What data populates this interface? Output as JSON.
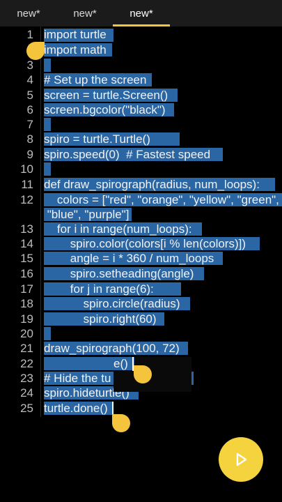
{
  "tabs": [
    {
      "label": "new*",
      "active": false
    },
    {
      "label": "new*",
      "active": false
    },
    {
      "label": "new*",
      "active": true
    }
  ],
  "editor": {
    "line_numbers": [
      "1",
      "2",
      "3",
      "4",
      "5",
      "6",
      "7",
      "8",
      "9",
      "10",
      "11",
      "12",
      "13",
      "14",
      "15",
      "16",
      "17",
      "18",
      "19",
      "20",
      "21",
      "22",
      "23",
      "24",
      "25"
    ],
    "code_lines": [
      "import turtle",
      "import math",
      "",
      "# Set up the screen",
      "screen = turtle.Screen()",
      "screen.bgcolor(\"black\")",
      "",
      "spiro = turtle.Turtle()",
      "spiro.speed(0)  # Fastest speed",
      "",
      "def draw_spirograph(radius, num_loops):",
      "    colors = [\"red\", \"orange\", \"yellow\", \"green\",",
      " \"blue\", \"purple\"]",
      "    for i in range(num_loops):",
      "        spiro.color(colors[i % len(colors)])",
      "        angle = i * 360 / num_loops",
      "        spiro.setheading(angle)",
      "        for j in range(6):",
      "            spiro.circle(radius)",
      "            spiro.right(60)",
      "",
      "draw_spirograph(100, 72)",
      "",
      "# Hide the tu",
      "spiro.hideturtle()",
      "turtle.done()"
    ],
    "popup_fragment": "e()"
  },
  "colors": {
    "background": "#000000",
    "tab_bar": "#1b1b1b",
    "selection": "#2a66a4",
    "accent": "#f5c53a"
  },
  "icons": {
    "run": "play-icon"
  }
}
